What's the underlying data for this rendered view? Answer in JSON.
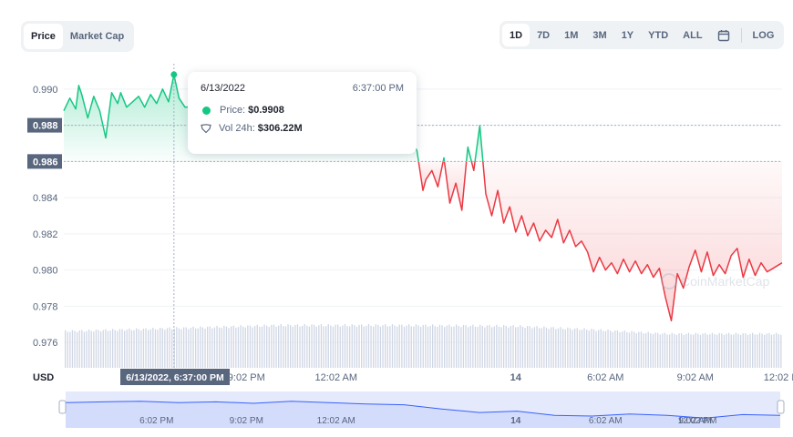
{
  "tabs": {
    "price_label": "Price",
    "market_cap_label": "Market Cap"
  },
  "ranges": {
    "d1": "1D",
    "d7": "7D",
    "m1": "1M",
    "m3": "3M",
    "y1": "1Y",
    "ytd": "YTD",
    "all": "ALL",
    "log": "LOG",
    "selected": "1D"
  },
  "tooltip": {
    "date": "6/13/2022",
    "time": "6:37:00 PM",
    "price_label": "Price:",
    "price_value": "$0.9908",
    "volume_label": "Vol 24h:",
    "volume_value": "$306.22M"
  },
  "crosshair_label": "6/13/2022, 6:37:00 PM",
  "watermark": "CoinMarketCap",
  "colors": {
    "up": "#16c784",
    "down": "#ea3943",
    "text": "#58667e",
    "axis_badge": "#58667e",
    "volume": "#cfd6e4",
    "navigator_fill": "#e4e9fc",
    "navigator_line": "#3861fb"
  },
  "chart_data": {
    "type": "line",
    "currency_label": "USD",
    "y_ticks": [
      "0.990",
      "0.988",
      "0.986",
      "0.984",
      "0.982",
      "0.980",
      "0.978",
      "0.976"
    ],
    "y_tick_values": [
      0.99,
      0.988,
      0.986,
      0.984,
      0.982,
      0.98,
      0.978,
      0.976
    ],
    "ylim": [
      0.9746,
      0.9914
    ],
    "x_ticks": [
      "6:02 PM",
      "9:02 PM",
      "12:02 AM",
      "14",
      "6:02 AM",
      "9:02 AM",
      "12:02 PM"
    ],
    "x_tick_hours": [
      0,
      3,
      6,
      12,
      12,
      15,
      18
    ],
    "xlim_hours": [
      -3.1,
      20.9
    ],
    "baseline": 0.986,
    "baseline_label": "0.986",
    "hover_label": "0.988",
    "hover_value": 0.988,
    "crosshair_hour": 0.58,
    "grid": true,
    "legend": "none",
    "price_series": {
      "hours": [
        -3.1,
        -2.9,
        -2.7,
        -2.6,
        -2.5,
        -2.3,
        -2.1,
        -1.9,
        -1.7,
        -1.5,
        -1.3,
        -1.2,
        -1.0,
        -0.8,
        -0.6,
        -0.4,
        -0.2,
        0.0,
        0.2,
        0.4,
        0.58,
        0.75,
        0.95,
        7.2,
        7.4,
        7.6,
        7.8,
        8.0,
        8.2,
        8.3,
        8.5,
        8.7,
        8.9,
        9.0,
        9.2,
        9.4,
        9.6,
        9.8,
        10.0,
        10.2,
        10.4,
        10.6,
        10.8,
        11.0,
        11.2,
        11.4,
        11.6,
        11.8,
        12.0,
        12.2,
        12.4,
        12.6,
        12.8,
        13.0,
        13.2,
        13.4,
        13.6,
        13.8,
        14.0,
        14.2,
        14.4,
        14.6,
        14.8,
        15.0,
        15.2,
        15.4,
        15.6,
        15.8,
        16.0,
        16.2,
        16.4,
        16.6,
        16.8,
        17.0,
        17.2,
        17.4,
        17.6,
        17.8,
        18.0,
        18.2,
        18.4,
        18.6,
        18.8,
        19.0,
        19.2,
        19.4,
        19.6,
        19.8,
        20.0,
        20.2,
        20.4,
        20.6,
        20.9
      ],
      "values": [
        0.9888,
        0.9895,
        0.9889,
        0.9902,
        0.9897,
        0.9884,
        0.9896,
        0.9888,
        0.9873,
        0.9898,
        0.9892,
        0.9898,
        0.989,
        0.9893,
        0.9896,
        0.989,
        0.9897,
        0.9892,
        0.99,
        0.9893,
        0.9908,
        0.9895,
        0.989,
        0.9897,
        0.9892,
        0.9888,
        0.9895,
        0.9893,
        0.9885,
        0.989,
        0.9873,
        0.9866,
        0.9844,
        0.985,
        0.9855,
        0.9846,
        0.9862,
        0.9837,
        0.9848,
        0.9833,
        0.9868,
        0.9855,
        0.988,
        0.9842,
        0.983,
        0.9844,
        0.9826,
        0.9835,
        0.9821,
        0.983,
        0.9819,
        0.9826,
        0.9816,
        0.9822,
        0.9818,
        0.9828,
        0.9815,
        0.9822,
        0.9813,
        0.9816,
        0.981,
        0.9799,
        0.9807,
        0.98,
        0.9804,
        0.9798,
        0.9806,
        0.9799,
        0.9805,
        0.9798,
        0.9803,
        0.9796,
        0.9801,
        0.9785,
        0.9772,
        0.9798,
        0.979,
        0.9802,
        0.9811,
        0.9799,
        0.981,
        0.9797,
        0.9803,
        0.9798,
        0.9808,
        0.9812,
        0.9796,
        0.9806,
        0.9797,
        0.9804,
        0.9799,
        0.9801,
        0.9804
      ]
    },
    "volume_hours": [
      -3.1,
      0.0,
      4.0,
      8.0,
      12.0,
      14.5,
      17.0,
      20.9
    ],
    "volume_relative": [
      0.86,
      0.92,
      1.0,
      1.0,
      0.98,
      0.9,
      0.8,
      0.8
    ],
    "navigator": {
      "x_ticks": [
        "6:02 PM",
        "9:02 PM",
        "12:02 AM",
        "14",
        "6:02 AM",
        "9:02 AM",
        "12:02 PM"
      ],
      "values": [
        0.9898,
        0.9899,
        0.99,
        0.9898,
        0.9899,
        0.9897,
        0.99,
        0.9898,
        0.9896,
        0.9895,
        0.9889,
        0.9884,
        0.9886,
        0.988,
        0.9879,
        0.9882,
        0.988,
        0.9876,
        0.9881,
        0.988
      ]
    }
  }
}
